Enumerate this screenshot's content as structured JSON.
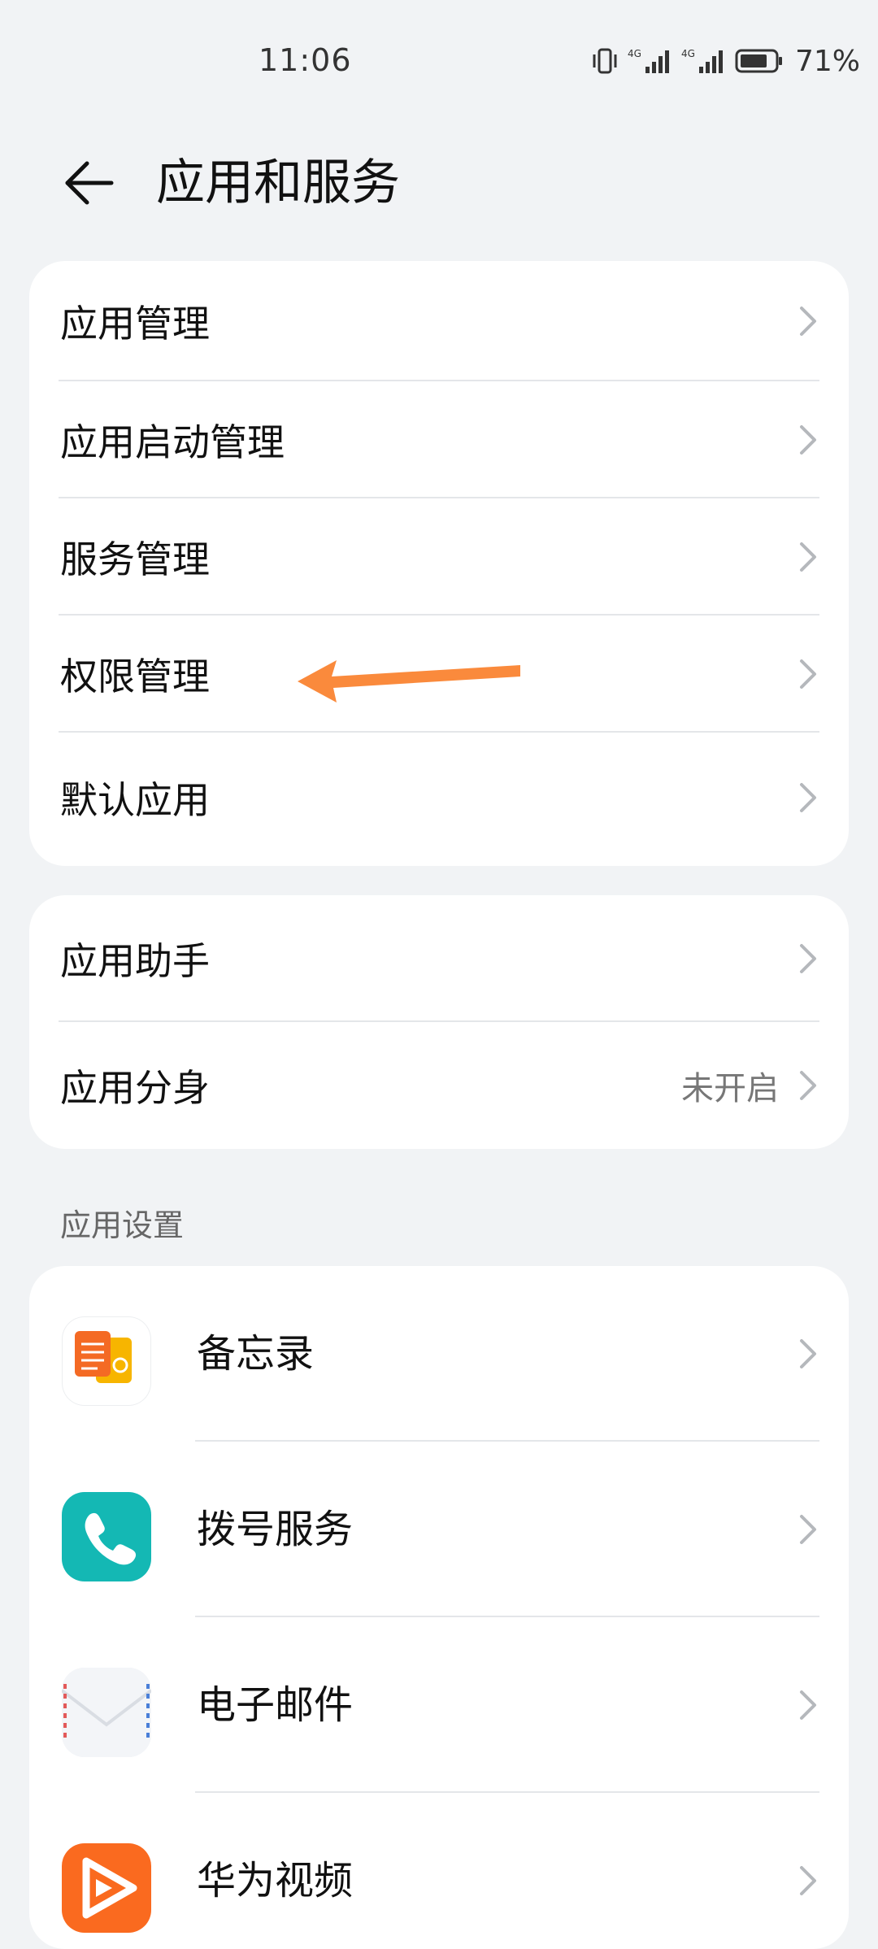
{
  "status": {
    "time": "11:06",
    "net1": "4G",
    "net2": "4G",
    "battery": "71%"
  },
  "header": {
    "title": "应用和服务"
  },
  "group1": {
    "items": [
      {
        "label": "应用管理"
      },
      {
        "label": "应用启动管理"
      },
      {
        "label": "服务管理"
      },
      {
        "label": "权限管理"
      },
      {
        "label": "默认应用"
      }
    ]
  },
  "group2": {
    "items": [
      {
        "label": "应用助手"
      },
      {
        "label": "应用分身",
        "value": "未开启"
      }
    ]
  },
  "section": {
    "label": "应用设置"
  },
  "apps": {
    "items": [
      {
        "label": "备忘录",
        "icon": "memo-icon"
      },
      {
        "label": "拨号服务",
        "icon": "phone-icon"
      },
      {
        "label": "电子邮件",
        "icon": "email-icon"
      },
      {
        "label": "华为视频",
        "icon": "video-icon"
      }
    ]
  },
  "colors": {
    "background": "#f1f3f5",
    "card": "#ffffff",
    "annotation_arrow": "#fa8a3c",
    "phone_icon": "#14b8b4",
    "video_icon": "#fa6a1f"
  }
}
